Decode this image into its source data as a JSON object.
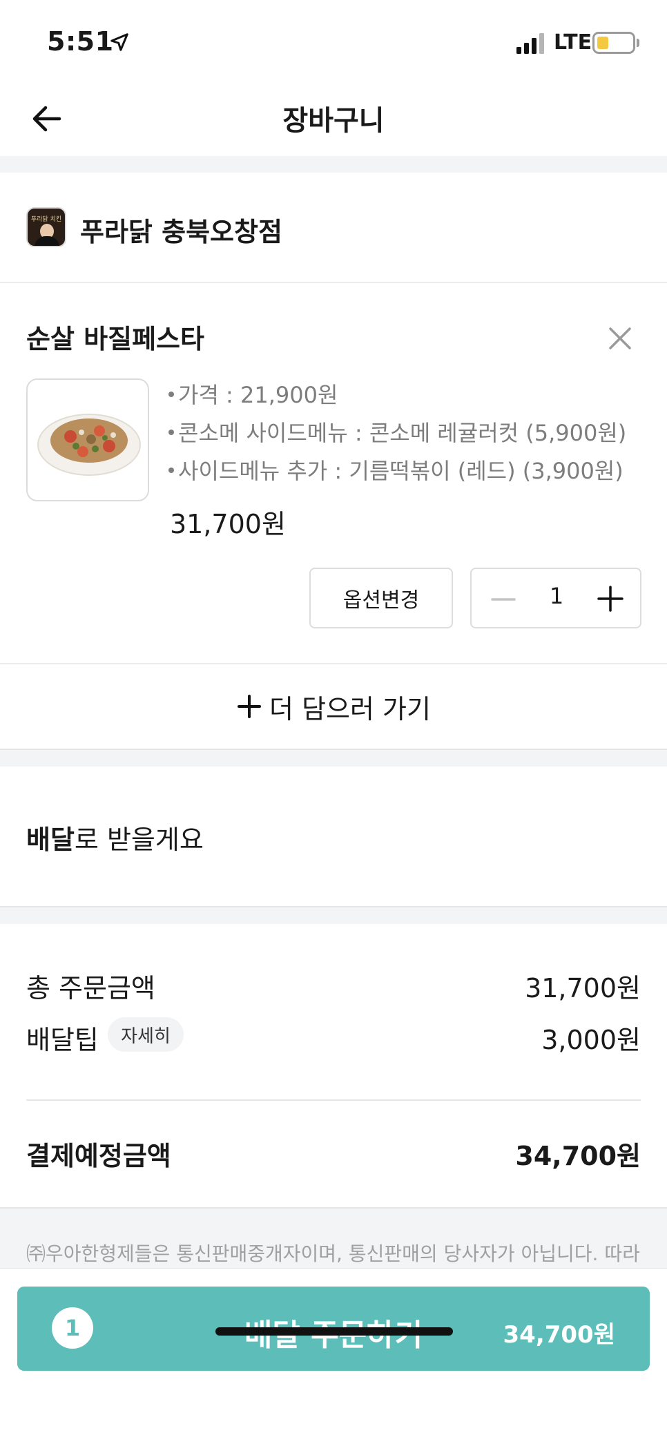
{
  "status_bar": {
    "time": "5:51",
    "network": "LTE"
  },
  "header": {
    "title": "장바구니"
  },
  "store": {
    "name": "푸라닭 충북오창점",
    "logo_text": "푸라닭 치킨"
  },
  "item": {
    "name": "순살 바질페스타",
    "options": [
      "가격 : 21,900원",
      "콘소메 사이드메뉴 : 콘소메 레귤러컷 (5,900원)",
      "사이드메뉴 추가 : 기름떡볶이 (레드) (3,900원)"
    ],
    "price": "31,700원",
    "option_change_label": "옵션변경",
    "quantity": "1"
  },
  "add_more_label": "더 담으러 가기",
  "delivery": {
    "strong": "배달",
    "rest": "로 받을게요"
  },
  "summary": {
    "order_total_label": "총 주문금액",
    "order_total_value": "31,700원",
    "delivery_tip_label": "배달팁",
    "detail_label": "자세히",
    "delivery_tip_value": "3,000원",
    "payment_label": "결제예정금액",
    "payment_value": "34,700원"
  },
  "disclaimer": "㈜우아한형제들은 통신판매중개자이며, 통신판매의 당사자가 아닙니다. 따라",
  "order_button": {
    "count": "1",
    "label": "배달 주문하기",
    "total": "34,700원"
  },
  "colors": {
    "accent": "#5dbdb8",
    "muted": "#7d7d7d",
    "section_gap": "#f3f4f5"
  },
  "icons": [
    "location-arrow-icon",
    "signal-icon",
    "battery-icon",
    "back-arrow-icon",
    "close-icon",
    "minus-icon",
    "plus-icon"
  ]
}
